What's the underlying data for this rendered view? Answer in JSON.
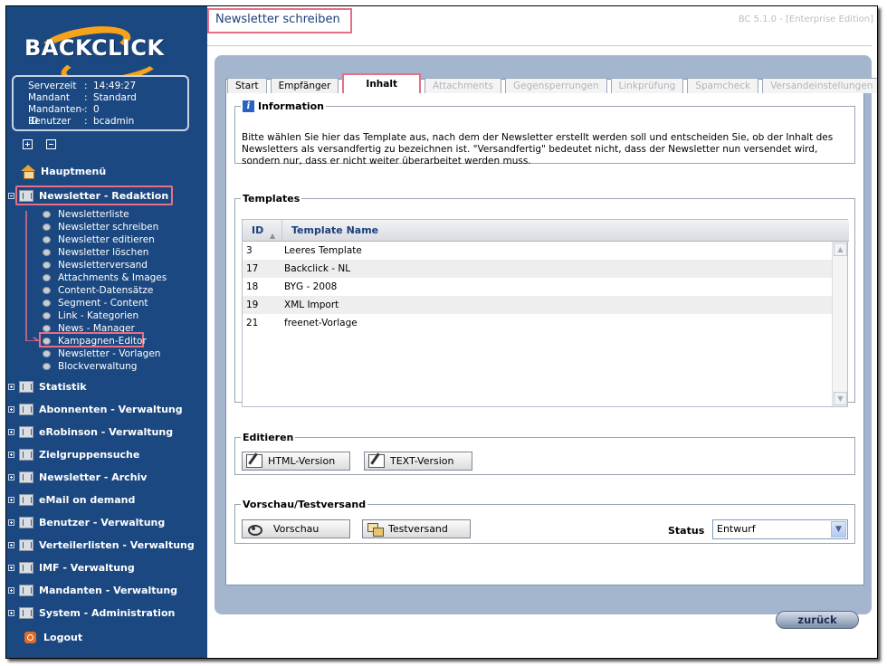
{
  "app": {
    "logo_text": "BACKCLICK",
    "version": "BC 5.1.0 - [Enterprise Edition]",
    "page_title": "Newsletter schreiben"
  },
  "server_info": [
    {
      "label": "Serverzeit",
      "value": "14:49:27"
    },
    {
      "label": "Mandant",
      "value": "Standard"
    },
    {
      "label": "Mandanten-ID",
      "value": "0"
    },
    {
      "label": "Benutzer",
      "value": "bcadmin"
    }
  ],
  "sidebar": {
    "home": "Hauptmenü",
    "active_section": "Newsletter - Redaktion",
    "sub_items": [
      "Newsletterliste",
      "Newsletter schreiben",
      "Newsletter editieren",
      "Newsletter löschen",
      "Newsletterversand",
      "Attachments & Images",
      "Content-Datensätze",
      "Segment - Content",
      "Link - Kategorien",
      "News - Manager",
      "Kampagnen-Editor",
      "Newsletter - Vorlagen",
      "Blockverwaltung"
    ],
    "sections": [
      "Statistik",
      "Abonnenten - Verwaltung",
      "eRobinson - Verwaltung",
      "Zielgruppensuche",
      "Newsletter - Archiv",
      "eMail on demand",
      "Benutzer - Verwaltung",
      "Verteilerlisten - Verwaltung",
      "IMF - Verwaltung",
      "Mandanten - Verwaltung",
      "System - Administration"
    ],
    "logout": "Logout"
  },
  "tabs": [
    {
      "label": "Start",
      "state": "normal"
    },
    {
      "label": "Empfänger",
      "state": "normal"
    },
    {
      "label": "Inhalt",
      "state": "active"
    },
    {
      "label": "Attachments",
      "state": "disabled"
    },
    {
      "label": "Gegensperrungen",
      "state": "disabled"
    },
    {
      "label": "Linkprüfung",
      "state": "disabled"
    },
    {
      "label": "Spamcheck",
      "state": "disabled"
    },
    {
      "label": "Versandeinstellungen",
      "state": "disabled"
    }
  ],
  "information": {
    "legend": "Information",
    "text": "Bitte wählen Sie hier das Template aus, nach dem der Newsletter erstellt werden soll und entscheiden Sie, ob der Inhalt des Newsletters als versandfertig zu bezeichnen ist. \"Versandfertig\" bedeutet nicht, dass der Newsletter nun versendet wird, sondern nur, dass er nicht weiter überarbeitet werden muss."
  },
  "templates": {
    "legend": "Templates",
    "columns": [
      "ID",
      "Template Name"
    ],
    "rows": [
      {
        "id": "3",
        "name": "Leeres Template"
      },
      {
        "id": "17",
        "name": "Backclick - NL"
      },
      {
        "id": "18",
        "name": "BYG - 2008"
      },
      {
        "id": "19",
        "name": "XML Import"
      },
      {
        "id": "21",
        "name": "freenet-Vorlage"
      }
    ]
  },
  "edit": {
    "legend": "Editieren",
    "html_button": "HTML-Version",
    "text_button": "TEXT-Version"
  },
  "preview": {
    "legend": "Vorschau/Testversand",
    "preview_button": "Vorschau",
    "testsend_button": "Testversand",
    "status_label": "Status",
    "status_value": "Entwurf"
  },
  "back_button": "zurück",
  "colors": {
    "sidebar_bg": "#1b4880",
    "accent_orange": "#f6a31c",
    "highlight_frame": "#e86f86",
    "panel_bg": "#a4b6ce",
    "title_blue": "#1b3f7a"
  }
}
